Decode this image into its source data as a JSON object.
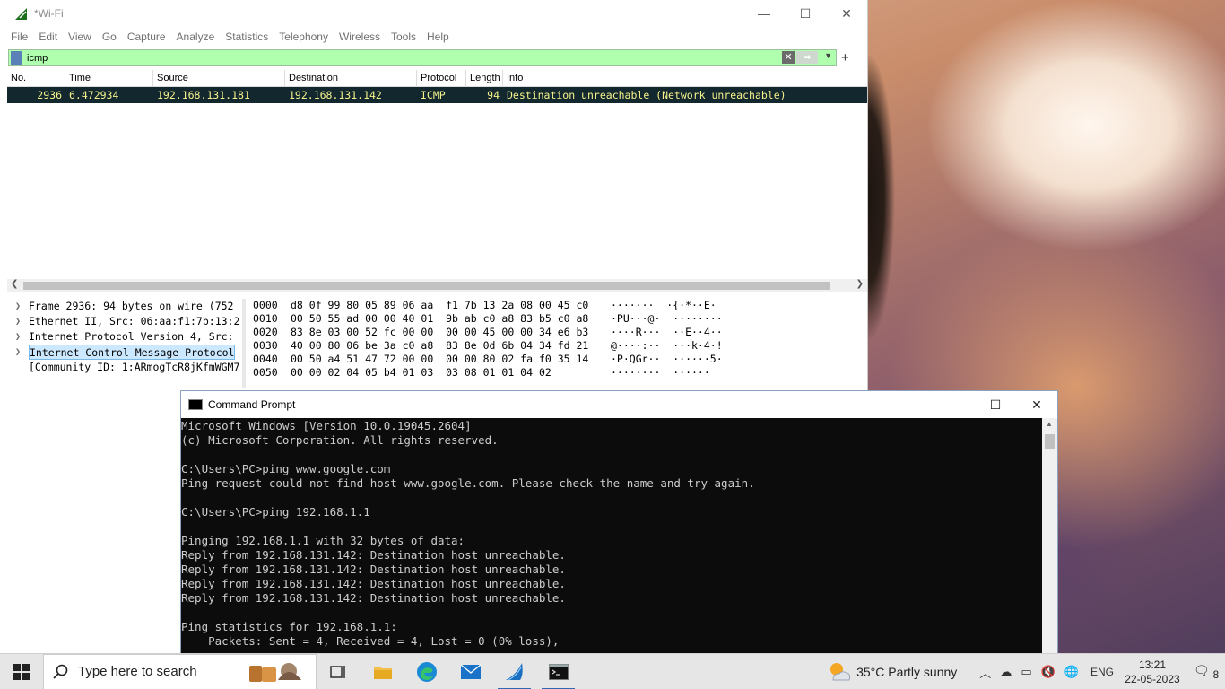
{
  "wireshark": {
    "title": "*Wi-Fi",
    "menu": [
      "File",
      "Edit",
      "View",
      "Go",
      "Capture",
      "Analyze",
      "Statistics",
      "Telephony",
      "Wireless",
      "Tools",
      "Help"
    ],
    "filter": {
      "value": "icmp"
    },
    "columns": [
      "No.",
      "Time",
      "Source",
      "Destination",
      "Protocol",
      "Length",
      "Info"
    ],
    "packet": {
      "no": "2936",
      "time": "6.472934",
      "source": "192.168.131.181",
      "destination": "192.168.131.142",
      "protocol": "ICMP",
      "length": "94",
      "info": "Destination unreachable (Network unreachable)"
    },
    "details": [
      "Frame 2936: 94 bytes on wire (752",
      "Ethernet II, Src: 06:aa:f1:7b:13:2",
      "Internet Protocol Version 4, Src:",
      "Internet Control Message Protocol",
      "[Community ID: 1:ARmogTcR8jKfmWGM7"
    ],
    "hex": [
      {
        "off": "0000",
        "bytes": "d8 0f 99 80 05 89 06 aa  f1 7b 13 2a 08 00 45 c0",
        "ascii": "·······  ·{·*··E·"
      },
      {
        "off": "0010",
        "bytes": "00 50 55 ad 00 00 40 01  9b ab c0 a8 83 b5 c0 a8",
        "ascii": "·PU···@·  ········"
      },
      {
        "off": "0020",
        "bytes": "83 8e 03 00 52 fc 00 00  00 00 45 00 00 34 e6 b3",
        "ascii": "····R···  ··E··4··"
      },
      {
        "off": "0030",
        "bytes": "40 00 80 06 be 3a c0 a8  83 8e 0d 6b 04 34 fd 21",
        "ascii": "@····:··  ···k·4·!"
      },
      {
        "off": "0040",
        "bytes": "00 50 a4 51 47 72 00 00  00 00 80 02 fa f0 35 14",
        "ascii": "·P·QGr··  ······5·"
      },
      {
        "off": "0050",
        "bytes": "00 00 02 04 05 b4 01 03  03 08 01 01 04 02",
        "ascii": "········  ······"
      }
    ]
  },
  "cmd": {
    "title": "Command Prompt",
    "lines": [
      "Microsoft Windows [Version 10.0.19045.2604]",
      "(c) Microsoft Corporation. All rights reserved.",
      "",
      "C:\\Users\\PC>ping www.google.com",
      "Ping request could not find host www.google.com. Please check the name and try again.",
      "",
      "C:\\Users\\PC>ping 192.168.1.1",
      "",
      "Pinging 192.168.1.1 with 32 bytes of data:",
      "Reply from 192.168.131.142: Destination host unreachable.",
      "Reply from 192.168.131.142: Destination host unreachable.",
      "Reply from 192.168.131.142: Destination host unreachable.",
      "Reply from 192.168.131.142: Destination host unreachable.",
      "",
      "Ping statistics for 192.168.1.1:",
      "    Packets: Sent = 4, Received = 4, Lost = 0 (0% loss),"
    ]
  },
  "taskbar": {
    "search_placeholder": "Type here to search",
    "weather": "35°C  Partly sunny",
    "lang": "ENG",
    "time": "13:21",
    "date": "22-05-2023",
    "notifications": "8"
  }
}
